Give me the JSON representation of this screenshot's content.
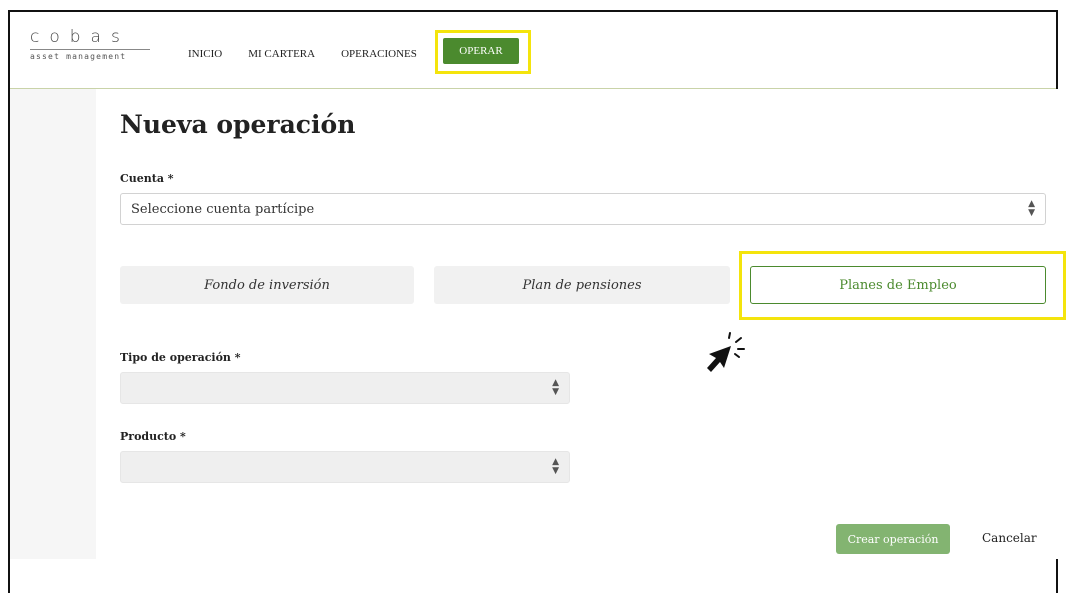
{
  "brand": {
    "name": "cobas",
    "tagline": "asset management"
  },
  "nav": {
    "items": [
      {
        "label": "INICIO"
      },
      {
        "label": "MI CARTERA"
      },
      {
        "label": "OPERACIONES"
      }
    ],
    "active_label": "OPERAR"
  },
  "page": {
    "title": "Nueva operación",
    "cuenta_label": "Cuenta *",
    "cuenta_placeholder": "Seleccione cuenta partícipe",
    "tabs": [
      {
        "label": "Fondo de inversión",
        "active": false
      },
      {
        "label": "Plan de pensiones",
        "active": false
      },
      {
        "label": "Planes de Empleo",
        "active": true
      }
    ],
    "tipo_label": "Tipo de operación *",
    "tipo_value": "",
    "producto_label": "Producto *",
    "producto_value": "",
    "crear_label": "Crear operación",
    "cancelar_label": "Cancelar"
  },
  "colors": {
    "accent": "#4b8a2e",
    "highlight": "#f4e40c",
    "button_disabled": "#7db06a"
  },
  "icons": {
    "select_arrow": "sort-arrows-icon",
    "cursor": "click-pointer-icon"
  }
}
